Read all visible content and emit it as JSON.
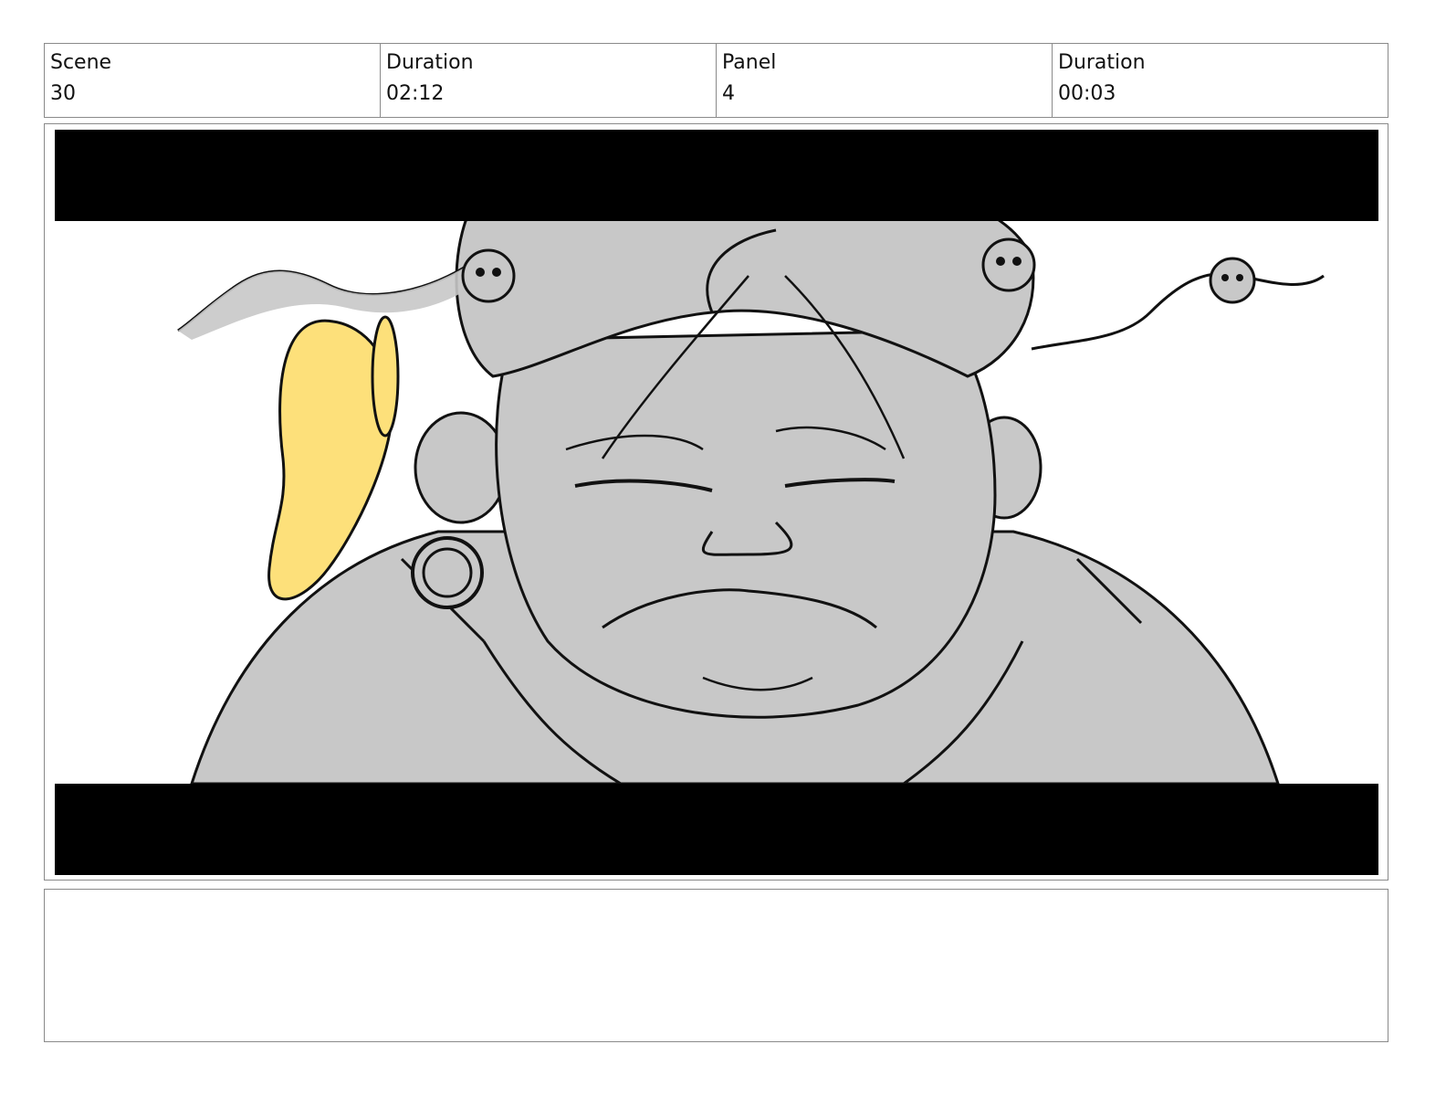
{
  "header": {
    "scene_label": "Scene",
    "scene_value": "30",
    "scene_duration_label": "Duration",
    "scene_duration_value": "02:12",
    "panel_label": "Panel",
    "panel_value": "4",
    "panel_duration_label": "Duration",
    "panel_duration_value": "00:03"
  },
  "notes": {
    "text": ""
  },
  "colors": {
    "letterbox": "#000000",
    "fill_gray": "#c8c8c8",
    "accent_yellow": "#fde07a",
    "line": "#111111"
  }
}
